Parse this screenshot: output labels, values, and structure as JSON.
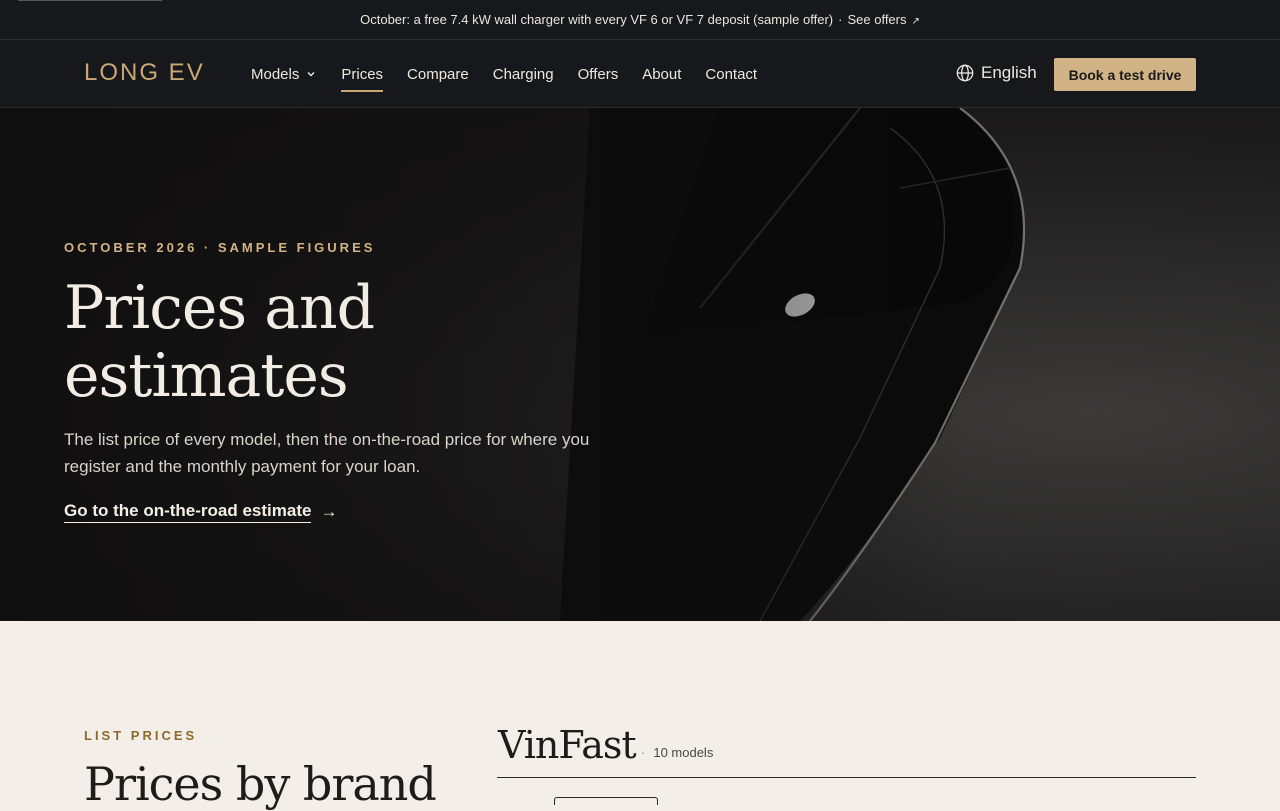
{
  "announcement": {
    "text": "October: a free 7.4 kW wall charger with every VF 6 or VF 7 deposit (sample offer)",
    "separator": "·",
    "link": "See offers",
    "arrow": "↗"
  },
  "nav": {
    "logo": "LONG EV",
    "items": [
      {
        "label": "Models",
        "has_dropdown": true
      },
      {
        "label": "Prices",
        "active": true
      },
      {
        "label": "Compare"
      },
      {
        "label": "Charging"
      },
      {
        "label": "Offers"
      },
      {
        "label": "About"
      },
      {
        "label": "Contact"
      }
    ],
    "language": "English",
    "cta": "Book a test drive"
  },
  "hero": {
    "eyebrow": "OCTOBER 2026 · SAMPLE FIGURES",
    "title_line1": "Prices and",
    "title_line2": "estimates",
    "subtitle": "The list price of every model, then the on-the-road price for where you register and the monthly payment for your loan.",
    "link": "Go to the on-the-road estimate",
    "link_arrow": "→"
  },
  "list_prices": {
    "eyebrow": "LIST PRICES",
    "title": "Prices by brand",
    "brand": "VinFast",
    "separator": "·",
    "count": "10 models"
  },
  "colors": {
    "accent": "#c9a774",
    "cta_bg": "#d2b385",
    "dark_bg": "#17181b",
    "cream_bg": "#f3eee7",
    "eyebrow_brown": "#8c6a2e"
  }
}
